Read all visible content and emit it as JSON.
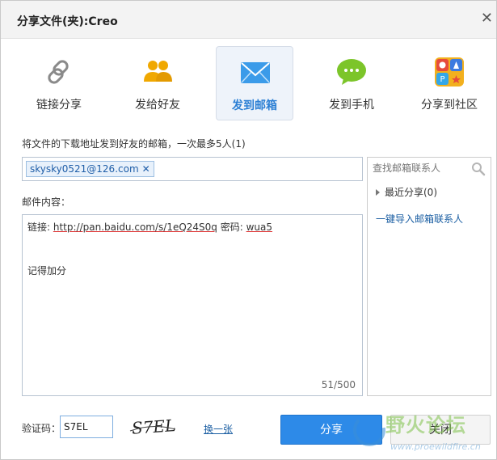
{
  "window": {
    "title": "分享文件(夹):Creo",
    "close_glyph": "✕"
  },
  "tabs": [
    {
      "label": "链接分享",
      "icon": "link-icon"
    },
    {
      "label": "发给好友",
      "icon": "friends-icon"
    },
    {
      "label": "发到邮箱",
      "icon": "mail-icon",
      "active": true
    },
    {
      "label": "发到手机",
      "icon": "chat-bubble-icon"
    },
    {
      "label": "分享到社区",
      "icon": "community-icon"
    }
  ],
  "email_form": {
    "description": "将文件的下载地址发到好友的邮箱，一次最多5人(1)",
    "recipient": "skysky0521@126.com",
    "chip_remove": "✕",
    "content_label": "邮件内容：",
    "message": {
      "line1_prefix": "链接: ",
      "url": "http://pan.baidu.com/s/1eQ24S0q",
      "code_label": " 密码: ",
      "code": "wua5",
      "line2": "记得加分"
    },
    "char_count": "51/500"
  },
  "contacts": {
    "search_placeholder": "查找邮箱联系人",
    "recent_label": "最近分享(0)",
    "import_link": "一键导入邮箱联系人"
  },
  "captcha": {
    "label": "验证码：",
    "value": "S7EL",
    "image_text": "S7EL",
    "refresh_link": "换一张"
  },
  "buttons": {
    "share": "分享",
    "close": "关闭"
  },
  "watermark": {
    "title": "野火论坛",
    "url": "www.proewildfire.cn"
  },
  "colors": {
    "accent": "#2d8ae8",
    "link": "#1c5fa3",
    "active_tab_bg": "#eef3fa"
  }
}
